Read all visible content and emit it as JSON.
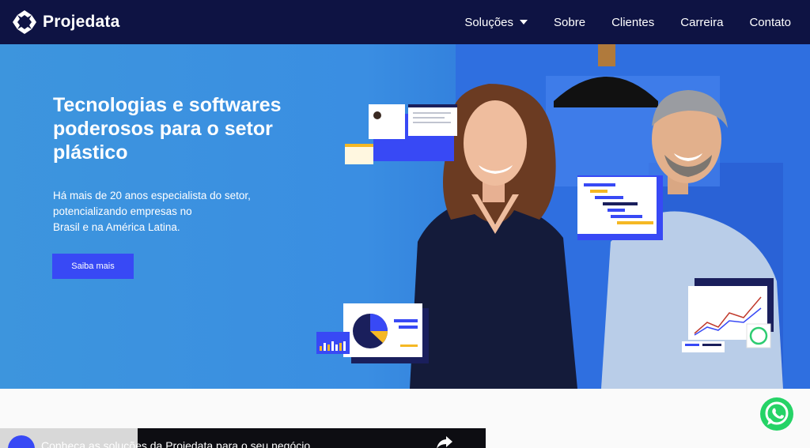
{
  "brand": {
    "name": "Projedata"
  },
  "nav": {
    "items": [
      {
        "label": "Soluções",
        "has_dropdown": true
      },
      {
        "label": "Sobre"
      },
      {
        "label": "Clientes"
      },
      {
        "label": "Carreira"
      },
      {
        "label": "Contato"
      }
    ]
  },
  "hero": {
    "title": "Tecnologias e softwares poderosos para o setor plástico",
    "description": "Há mais de 20 anos especialista do setor,\npotencializando empresas no\nBrasil e na América Latina.",
    "cta_label": "Saiba mais"
  },
  "video": {
    "title": "Conheça as soluções da Projedata para o seu negócio"
  },
  "colors": {
    "navbar": "#0e1343",
    "hero_blue": "#3a8ee2",
    "accent": "#3849f5",
    "chart_navy": "#1a1f5c",
    "chart_yellow": "#f5b824",
    "whatsapp_green": "#25d366"
  },
  "icons": {
    "logo": "projedata-logo-icon",
    "dropdown": "caret-down-icon",
    "share": "share-icon",
    "whatsapp": "whatsapp-icon"
  }
}
